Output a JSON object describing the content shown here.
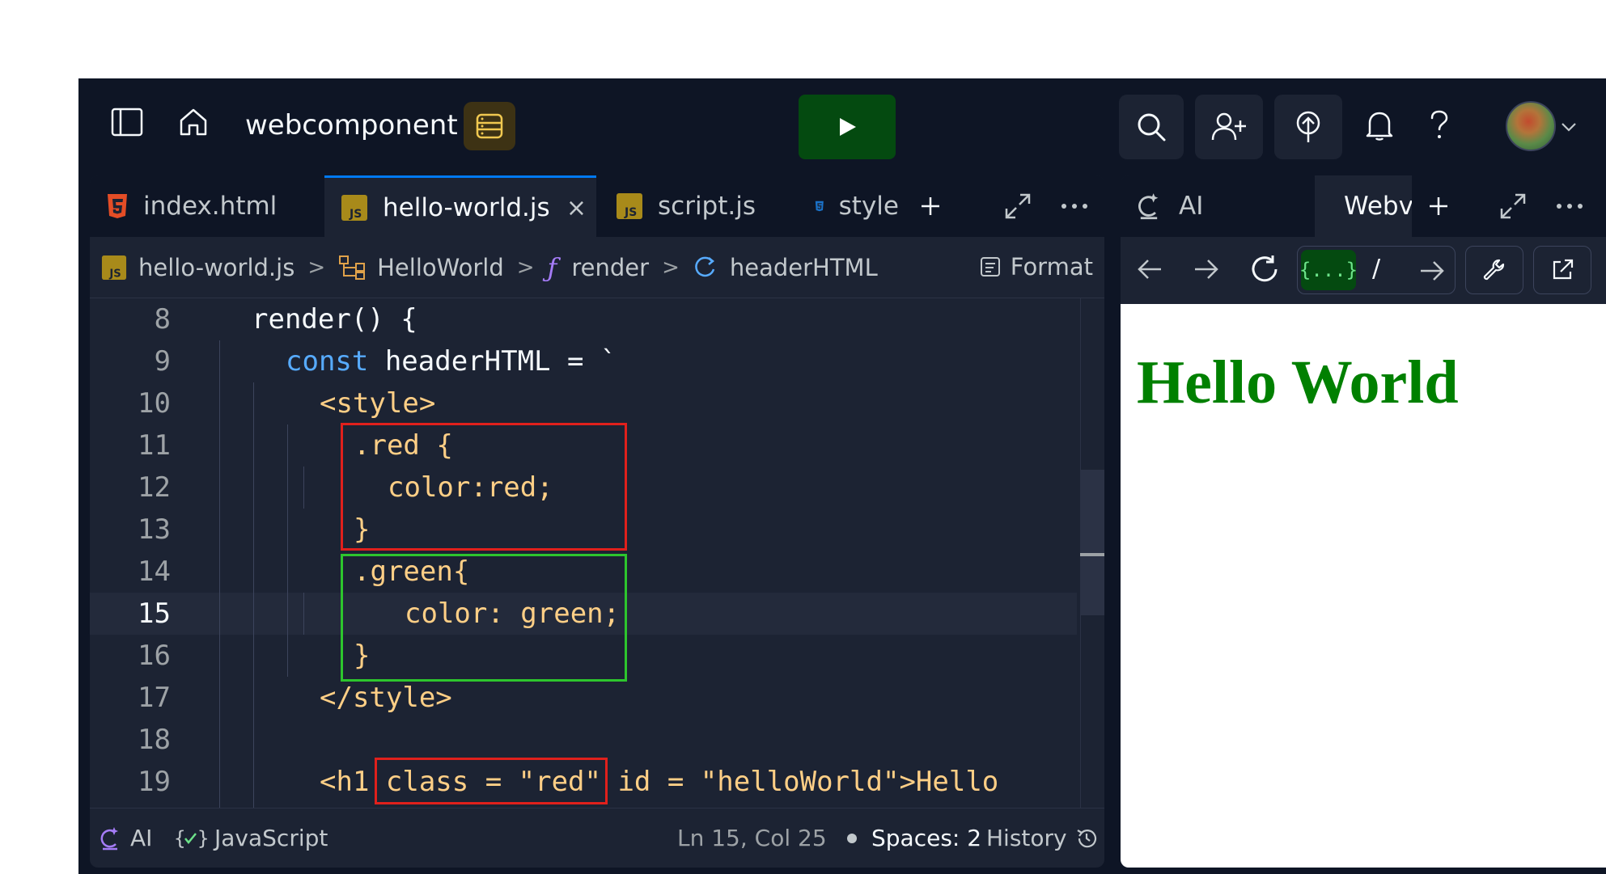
{
  "app": {
    "project_name": "webcomponent",
    "colors": {
      "bg": "#0e1525",
      "surface": "#1c2333",
      "run": "#044a10",
      "accent": "#0079f2"
    }
  },
  "topbar": {
    "icons": [
      "sidebar-toggle-icon",
      "home-icon",
      "database-icon",
      "play-icon",
      "search-icon",
      "invite-icon",
      "deploy-icon",
      "bell-icon",
      "help-icon",
      "avatar",
      "chevron-down-icon"
    ]
  },
  "editor": {
    "tabs": [
      {
        "label": "index.html",
        "icon": "html5-icon"
      },
      {
        "label": "hello-world.js",
        "icon": "js-file-icon",
        "active": true
      },
      {
        "label": "script.js",
        "icon": "js-file-icon"
      },
      {
        "label": "style",
        "icon": "css3-icon"
      }
    ],
    "tab_close": "×",
    "breadcrumb": {
      "file": "hello-world.js",
      "class": "HelloWorld",
      "method": "render",
      "variable": "headerHTML",
      "format_label": "Format"
    },
    "code_lines": [
      {
        "n": "8"
      },
      {
        "n": "9"
      },
      {
        "n": "10"
      },
      {
        "n": "11"
      },
      {
        "n": "12"
      },
      {
        "n": "13"
      },
      {
        "n": "14"
      },
      {
        "n": "15"
      },
      {
        "n": "16"
      },
      {
        "n": "17"
      },
      {
        "n": "18"
      },
      {
        "n": "19"
      }
    ],
    "code": {
      "l8": "render() {",
      "l9_kw": "const",
      "l9_rest": " headerHTML = `",
      "l10": "<style>",
      "l11": ".red {",
      "l12": "color:red;",
      "l13": "}",
      "l14": ".green{",
      "l15": "color: green;",
      "l16": "}",
      "l17": "</style>",
      "l19": "<h1 class = \"red\" id = \"helloWorld\">Hello"
    },
    "status": {
      "ai_label": "AI",
      "language": "JavaScript",
      "cursor": "Ln 15, Col 25",
      "spaces": "Spaces: 2",
      "history": "History"
    }
  },
  "webview": {
    "tabs": [
      {
        "label": "AI",
        "icon": "ai-sparkle-icon"
      },
      {
        "label": "Webview",
        "icon": "monitor-icon",
        "active": true
      }
    ],
    "url_badge": "{...}",
    "url_path": "/",
    "page_heading": "Hello World"
  }
}
